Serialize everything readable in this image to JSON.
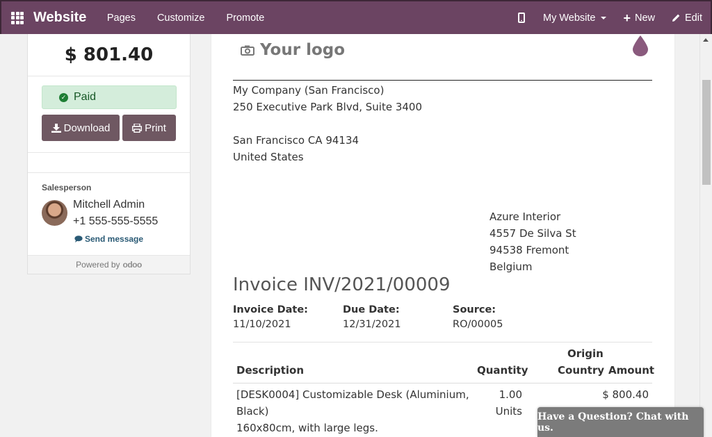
{
  "topbar": {
    "brand": "Website",
    "nav": [
      "Pages",
      "Customize",
      "Promote"
    ],
    "website_selector": "My Website",
    "new_label": "New",
    "edit_label": "Edit"
  },
  "sidebar": {
    "amount": "$ 801.40",
    "status": "Paid",
    "download_label": "Download",
    "print_label": "Print",
    "salesperson_label": "Salesperson",
    "salesperson_name": "Mitchell Admin",
    "salesperson_phone": "+1 555-555-5555",
    "send_message": "Send message",
    "powered_by": "Powered by",
    "powered_brand": "odoo"
  },
  "invoice": {
    "logo_text": "Your logo",
    "company": [
      "My Company (San Francisco)",
      "250 Executive Park Blvd, Suite 3400",
      "",
      "San Francisco CA 94134",
      "United States"
    ],
    "partner": [
      "Azure Interior",
      "4557 De Silva St",
      "94538 Fremont",
      "Belgium"
    ],
    "title": "Invoice INV/2021/00009",
    "invoice_date_label": "Invoice Date:",
    "invoice_date": "11/10/2021",
    "due_date_label": "Due Date:",
    "due_date": "12/31/2021",
    "source_label": "Source:",
    "source": "RO/00005",
    "columns": {
      "description": "Description",
      "quantity": "Quantity",
      "origin_line1": "Origin",
      "origin_line2": "Country",
      "amount": "Amount"
    },
    "lines": [
      {
        "description_line1": "[DESK0004] Customizable Desk (Aluminium,",
        "description_line2": "Black)",
        "description_line3": "160x80cm, with large legs.",
        "quantity": "1.00",
        "unit": "Units",
        "amount": "$ 800.40"
      }
    ]
  },
  "chat": {
    "label": "Have a Question? Chat with us."
  }
}
